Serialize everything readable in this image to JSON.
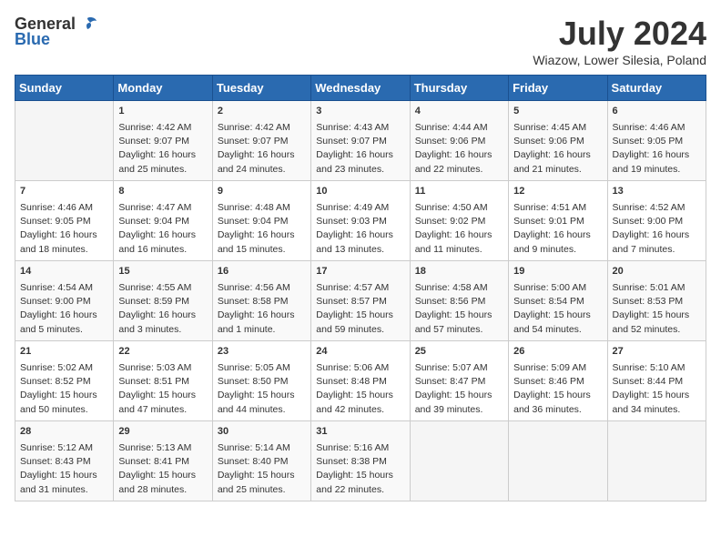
{
  "header": {
    "logo_general": "General",
    "logo_blue": "Blue",
    "month_title": "July 2024",
    "location": "Wiazow, Lower Silesia, Poland"
  },
  "days_of_week": [
    "Sunday",
    "Monday",
    "Tuesday",
    "Wednesday",
    "Thursday",
    "Friday",
    "Saturday"
  ],
  "weeks": [
    [
      {
        "day": "",
        "content": ""
      },
      {
        "day": "1",
        "content": "Sunrise: 4:42 AM\nSunset: 9:07 PM\nDaylight: 16 hours\nand 25 minutes."
      },
      {
        "day": "2",
        "content": "Sunrise: 4:42 AM\nSunset: 9:07 PM\nDaylight: 16 hours\nand 24 minutes."
      },
      {
        "day": "3",
        "content": "Sunrise: 4:43 AM\nSunset: 9:07 PM\nDaylight: 16 hours\nand 23 minutes."
      },
      {
        "day": "4",
        "content": "Sunrise: 4:44 AM\nSunset: 9:06 PM\nDaylight: 16 hours\nand 22 minutes."
      },
      {
        "day": "5",
        "content": "Sunrise: 4:45 AM\nSunset: 9:06 PM\nDaylight: 16 hours\nand 21 minutes."
      },
      {
        "day": "6",
        "content": "Sunrise: 4:46 AM\nSunset: 9:05 PM\nDaylight: 16 hours\nand 19 minutes."
      }
    ],
    [
      {
        "day": "7",
        "content": "Sunrise: 4:46 AM\nSunset: 9:05 PM\nDaylight: 16 hours\nand 18 minutes."
      },
      {
        "day": "8",
        "content": "Sunrise: 4:47 AM\nSunset: 9:04 PM\nDaylight: 16 hours\nand 16 minutes."
      },
      {
        "day": "9",
        "content": "Sunrise: 4:48 AM\nSunset: 9:04 PM\nDaylight: 16 hours\nand 15 minutes."
      },
      {
        "day": "10",
        "content": "Sunrise: 4:49 AM\nSunset: 9:03 PM\nDaylight: 16 hours\nand 13 minutes."
      },
      {
        "day": "11",
        "content": "Sunrise: 4:50 AM\nSunset: 9:02 PM\nDaylight: 16 hours\nand 11 minutes."
      },
      {
        "day": "12",
        "content": "Sunrise: 4:51 AM\nSunset: 9:01 PM\nDaylight: 16 hours\nand 9 minutes."
      },
      {
        "day": "13",
        "content": "Sunrise: 4:52 AM\nSunset: 9:00 PM\nDaylight: 16 hours\nand 7 minutes."
      }
    ],
    [
      {
        "day": "14",
        "content": "Sunrise: 4:54 AM\nSunset: 9:00 PM\nDaylight: 16 hours\nand 5 minutes."
      },
      {
        "day": "15",
        "content": "Sunrise: 4:55 AM\nSunset: 8:59 PM\nDaylight: 16 hours\nand 3 minutes."
      },
      {
        "day": "16",
        "content": "Sunrise: 4:56 AM\nSunset: 8:58 PM\nDaylight: 16 hours\nand 1 minute."
      },
      {
        "day": "17",
        "content": "Sunrise: 4:57 AM\nSunset: 8:57 PM\nDaylight: 15 hours\nand 59 minutes."
      },
      {
        "day": "18",
        "content": "Sunrise: 4:58 AM\nSunset: 8:56 PM\nDaylight: 15 hours\nand 57 minutes."
      },
      {
        "day": "19",
        "content": "Sunrise: 5:00 AM\nSunset: 8:54 PM\nDaylight: 15 hours\nand 54 minutes."
      },
      {
        "day": "20",
        "content": "Sunrise: 5:01 AM\nSunset: 8:53 PM\nDaylight: 15 hours\nand 52 minutes."
      }
    ],
    [
      {
        "day": "21",
        "content": "Sunrise: 5:02 AM\nSunset: 8:52 PM\nDaylight: 15 hours\nand 50 minutes."
      },
      {
        "day": "22",
        "content": "Sunrise: 5:03 AM\nSunset: 8:51 PM\nDaylight: 15 hours\nand 47 minutes."
      },
      {
        "day": "23",
        "content": "Sunrise: 5:05 AM\nSunset: 8:50 PM\nDaylight: 15 hours\nand 44 minutes."
      },
      {
        "day": "24",
        "content": "Sunrise: 5:06 AM\nSunset: 8:48 PM\nDaylight: 15 hours\nand 42 minutes."
      },
      {
        "day": "25",
        "content": "Sunrise: 5:07 AM\nSunset: 8:47 PM\nDaylight: 15 hours\nand 39 minutes."
      },
      {
        "day": "26",
        "content": "Sunrise: 5:09 AM\nSunset: 8:46 PM\nDaylight: 15 hours\nand 36 minutes."
      },
      {
        "day": "27",
        "content": "Sunrise: 5:10 AM\nSunset: 8:44 PM\nDaylight: 15 hours\nand 34 minutes."
      }
    ],
    [
      {
        "day": "28",
        "content": "Sunrise: 5:12 AM\nSunset: 8:43 PM\nDaylight: 15 hours\nand 31 minutes."
      },
      {
        "day": "29",
        "content": "Sunrise: 5:13 AM\nSunset: 8:41 PM\nDaylight: 15 hours\nand 28 minutes."
      },
      {
        "day": "30",
        "content": "Sunrise: 5:14 AM\nSunset: 8:40 PM\nDaylight: 15 hours\nand 25 minutes."
      },
      {
        "day": "31",
        "content": "Sunrise: 5:16 AM\nSunset: 8:38 PM\nDaylight: 15 hours\nand 22 minutes."
      },
      {
        "day": "",
        "content": ""
      },
      {
        "day": "",
        "content": ""
      },
      {
        "day": "",
        "content": ""
      }
    ]
  ]
}
